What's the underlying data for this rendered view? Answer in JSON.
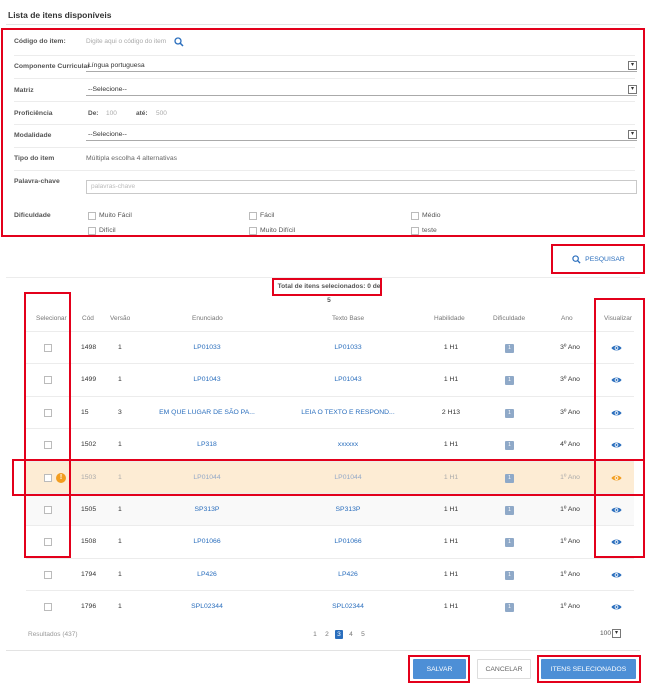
{
  "page_title": "Lista de itens disponíveis",
  "filters": {
    "codigo": {
      "label": "Código do item:",
      "placeholder": "Digite aqui o código do item"
    },
    "componente": {
      "label": "Componente Curricular",
      "value": "Língua portuguesa"
    },
    "matriz": {
      "label": "Matriz",
      "value": "--Selecione--"
    },
    "proficiencia": {
      "label": "Proficiência",
      "de_label": "De:",
      "de_value": "100",
      "ate_label": "até:",
      "ate_value": "500"
    },
    "modalidade": {
      "label": "Modalidade",
      "value": "--Selecione--"
    },
    "tipo": {
      "label": "Tipo do item",
      "value": "Múltipla escolha 4 alternativas"
    },
    "palavra": {
      "label": "Palavra-chave",
      "placeholder": "palavras-chave"
    },
    "dificuldade": {
      "label": "Dificuldade",
      "options": [
        "Muito Fácil",
        "Fácil",
        "Médio",
        "Difícil",
        "Muito Difícil",
        "teste"
      ]
    }
  },
  "search_button": "PESQUISAR",
  "total_selected": "Total de itens selecionados: 0 de 5",
  "columns": [
    "Selecionar",
    "Cód",
    "Versão",
    "Enunciado",
    "Texto Base",
    "Habilidade",
    "Dificuldade",
    "Ano",
    "Visualizar"
  ],
  "rows": [
    {
      "cod": "1498",
      "versao": "1",
      "enunciado": "LP01033",
      "texto": "LP01033",
      "habilidade": "1 H1",
      "dificuldade": "1",
      "ano": "3º Ano"
    },
    {
      "cod": "1499",
      "versao": "1",
      "enunciado": "LP01043",
      "texto": "LP01043",
      "habilidade": "1 H1",
      "dificuldade": "1",
      "ano": "3º Ano"
    },
    {
      "cod": "15",
      "versao": "3",
      "enunciado": "EM QUE LUGAR DE SÃO PA...",
      "texto": "LEIA O TEXTO E RESPOND...",
      "habilidade": "2 H13",
      "dificuldade": "1",
      "ano": "3º Ano"
    },
    {
      "cod": "1502",
      "versao": "1",
      "enunciado": "LP318",
      "texto": "xxxxxx",
      "habilidade": "1 H1",
      "dificuldade": "1",
      "ano": "4º Ano"
    },
    {
      "cod": "1503",
      "versao": "1",
      "enunciado": "LP01044",
      "texto": "LP01044",
      "habilidade": "1 H1",
      "dificuldade": "1",
      "ano": "1º Ano"
    },
    {
      "cod": "1505",
      "versao": "1",
      "enunciado": "SP313P",
      "texto": "SP313P",
      "habilidade": "1 H1",
      "dificuldade": "1",
      "ano": "1º Ano"
    },
    {
      "cod": "1508",
      "versao": "1",
      "enunciado": "LP01066",
      "texto": "LP01066",
      "habilidade": "1 H1",
      "dificuldade": "1",
      "ano": "1º Ano"
    },
    {
      "cod": "1794",
      "versao": "1",
      "enunciado": "LP426",
      "texto": "LP426",
      "habilidade": "1 H1",
      "dificuldade": "1",
      "ano": "1º Ano"
    },
    {
      "cod": "1796",
      "versao": "1",
      "enunciado": "SPL02344",
      "texto": "SPL02344",
      "habilidade": "1 H1",
      "dificuldade": "1",
      "ano": "1º Ano"
    }
  ],
  "warning_glyph": "!",
  "results": "Resultados (437)",
  "pages": [
    "1",
    "2",
    "3",
    "4",
    "5"
  ],
  "current_page": "3",
  "per_page": "100",
  "buttons": {
    "save": "SALVAR",
    "cancel": "CANCELAR",
    "selected": "ITENS SELECIONADOS"
  },
  "colors": {
    "accent": "#2a6ebd",
    "button": "#4d8fd6",
    "highlight": "#e3001b",
    "selected_row": "#fdecd4",
    "warning": "#f29d1f"
  }
}
